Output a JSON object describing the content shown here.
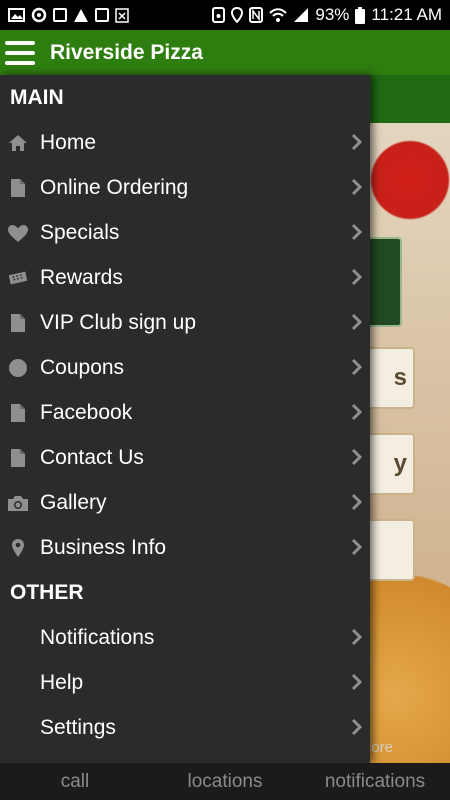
{
  "status_bar": {
    "battery": "93%",
    "time": "11:21 AM",
    "notification_icons": [
      "image-icon",
      "sync-icon",
      "flipboard-icon",
      "warning-icon",
      "flipboard-icon",
      "app-icon"
    ],
    "system_icons": [
      "save-icon",
      "location-icon",
      "nfc-icon",
      "wifi-icon",
      "signal-icon",
      "battery-icon"
    ]
  },
  "app_bar": {
    "title": "Riverside Pizza"
  },
  "drawer": {
    "main_header": "MAIN",
    "main_items": [
      {
        "label": "Home",
        "icon": "home-icon"
      },
      {
        "label": "Online Ordering",
        "icon": "document-icon"
      },
      {
        "label": "Specials",
        "icon": "heart-icon"
      },
      {
        "label": "Rewards",
        "icon": "ticket-icon"
      },
      {
        "label": "VIP Club sign up",
        "icon": "document-icon"
      },
      {
        "label": "Coupons",
        "icon": "circle-icon"
      },
      {
        "label": "Facebook",
        "icon": "document-icon"
      },
      {
        "label": "Contact Us",
        "icon": "document-icon"
      },
      {
        "label": "Gallery",
        "icon": "camera-icon"
      },
      {
        "label": "Business Info",
        "icon": "map-pin-icon"
      }
    ],
    "other_header": "OTHER",
    "other_items": [
      {
        "label": "Notifications"
      },
      {
        "label": "Help"
      },
      {
        "label": "Settings"
      }
    ]
  },
  "background": {
    "tile_labels": [
      "s",
      "y",
      ""
    ],
    "more_text": "lore"
  },
  "bottom_bar": {
    "tabs": [
      "call",
      "locations",
      "notifications"
    ]
  },
  "colors": {
    "app_bar": "#2e7d0f",
    "drawer": "#2b2b2b",
    "icon_gray": "#8f8f8f"
  }
}
